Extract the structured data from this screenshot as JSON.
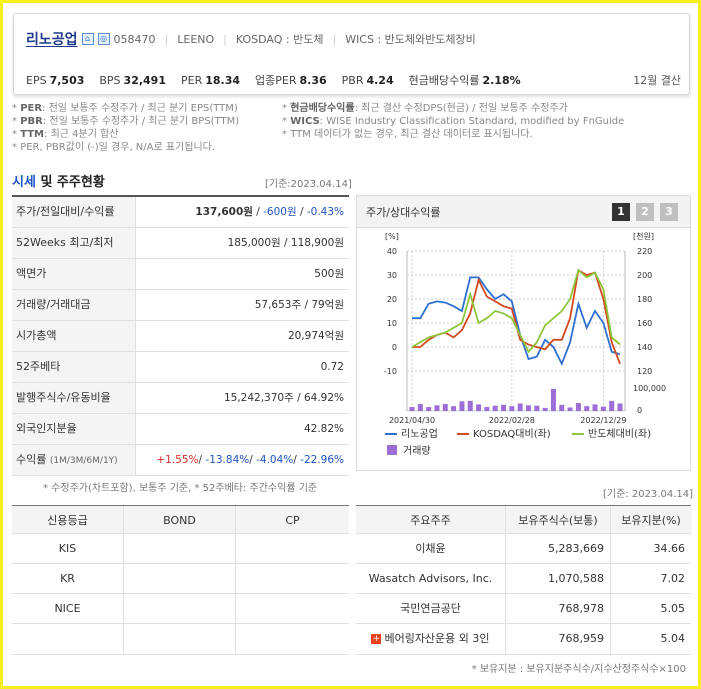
{
  "header": {
    "company_name": "리노공업",
    "code": "058470",
    "english_name": "LEENO",
    "market": "KOSDAQ : 반도체",
    "wics": "WICS : 반도체와반도체장비",
    "metrics": [
      {
        "label": "EPS",
        "value": "7,503"
      },
      {
        "label": "BPS",
        "value": "32,491"
      },
      {
        "label": "PER",
        "value": "18.34"
      },
      {
        "label": "업종PER",
        "value": "8.36"
      },
      {
        "label": "PBR",
        "value": "4.24"
      },
      {
        "label": "현금배당수익률",
        "value": "2.18%"
      }
    ],
    "settlement": "12월 결산"
  },
  "notes_left": [
    {
      "k": "PER",
      "t": ": 전일 보통주 수정주가 / 최근 분기 EPS(TTM)"
    },
    {
      "k": "PBR",
      "t": ": 전일 보통주 수정주가 / 최근 분기 BPS(TTM)"
    },
    {
      "k": "TTM",
      "t": ": 최근 4분기 합산"
    },
    {
      "k": "",
      "t": "PER, PBR값이 (-)일 경우, N/A로 표기됩니다."
    }
  ],
  "notes_right": [
    {
      "k": "현금배당수익률",
      "t": ": 최근 결산 수정DPS(현금) / 전일 보통주 수정주가"
    },
    {
      "k": "WICS",
      "t": ": WISE Industry Classification Standard, modified by FnGuide"
    },
    {
      "k": "",
      "t": "TTM 데이터가 없는 경우, 최근 결산 데이터로 표시됩니다."
    }
  ],
  "section": {
    "title_blue": "시세",
    "title_rest": " 및 주주현황",
    "basis": "[기준:2023.04.14]"
  },
  "market_table": [
    {
      "label": "주가/전일대비/수익률",
      "value_html": "price"
    },
    {
      "label": "52Weeks 최고/최저",
      "value": "185,000원 / 118,900원"
    },
    {
      "label": "액면가",
      "value": "500원"
    },
    {
      "label": "거래량/거래대금",
      "value": "57,653주 / 79억원"
    },
    {
      "label": "시가총액",
      "value": "20,974억원"
    },
    {
      "label": "52주베타",
      "value": "0.72"
    },
    {
      "label": "발행주식수/유동비율",
      "value": "15,242,370주 / 64.92%"
    },
    {
      "label": "외국인지분율",
      "value": "42.82%"
    },
    {
      "label": "수익률",
      "label_small": "(1M/3M/6M/1Y)",
      "value_html": "returns"
    }
  ],
  "price": {
    "price": "137,600원",
    "change": "-600원",
    "rate": "-0.43%"
  },
  "returns": {
    "r1m": "+1.55%",
    "r3m": "-13.84%",
    "r6m": "-4.04%",
    "r1y": "-22.96%"
  },
  "market_note": "* 수정주가(차트포함), 보통주 기준, * 52주베타: 주간수익률 기준",
  "chart_panel": {
    "title": "주가/상대수익률",
    "pages": [
      "1",
      "2",
      "3"
    ]
  },
  "chart_data": {
    "type": "line",
    "title": "",
    "ylabel_left": "[%]",
    "ylabel_right": "[천원]",
    "ylim_left": [
      -10,
      40
    ],
    "yticks_left": [
      -10,
      0,
      10,
      20,
      30,
      40
    ],
    "ylim_right": [
      120,
      220
    ],
    "yticks_right": [
      120,
      140,
      160,
      180,
      200,
      220
    ],
    "volume_ticks": [
      "100,000",
      "0"
    ],
    "x_labels": [
      "2021/04/30",
      "2022/02/28",
      "2022/12/29"
    ],
    "series": [
      {
        "name": "리노공업",
        "color": "#2f6fd1",
        "values": [
          12,
          12,
          18,
          19,
          18.5,
          17,
          15,
          29,
          29,
          24,
          20,
          22,
          19,
          5,
          -5,
          -4,
          3,
          0,
          -7,
          2,
          18,
          8,
          15,
          10,
          -2,
          -3
        ]
      },
      {
        "name": "KOSDAQ대비(좌)",
        "color": "#d24a20",
        "values": [
          0,
          0,
          3,
          5,
          6,
          4,
          7,
          14,
          28,
          21,
          19,
          17,
          16,
          3,
          1,
          0,
          -1,
          3,
          3,
          12,
          32,
          30,
          31,
          20,
          2,
          -7
        ]
      },
      {
        "name": "반도체대비(좌)",
        "color": "#8fc53a",
        "values": [
          0,
          2,
          4,
          5,
          6,
          8,
          10,
          22,
          10,
          12,
          15,
          14,
          12,
          5,
          -2,
          2,
          9,
          12,
          15,
          20,
          32,
          29,
          31,
          24,
          4,
          1
        ]
      },
      {
        "name": "거래량",
        "color": "#9b6fd6",
        "type": "bar",
        "values": [
          18,
          32,
          18,
          26,
          32,
          22,
          44,
          46,
          30,
          18,
          24,
          28,
          22,
          34,
          26,
          24,
          14,
          100,
          28,
          16,
          36,
          22,
          30,
          20,
          46,
          34
        ]
      }
    ]
  },
  "credit_table": {
    "headers": [
      "신용등급",
      "BOND",
      "CP"
    ],
    "rows": [
      [
        "KIS",
        "",
        ""
      ],
      [
        "KR",
        "",
        ""
      ],
      [
        "NICE",
        "",
        ""
      ],
      [
        "",
        "",
        ""
      ]
    ]
  },
  "holders_basis": "[기준: 2023.04.14]",
  "holders_table": {
    "headers": [
      "주요주주",
      "보유주식수(보통)",
      "보유지분(%)"
    ],
    "rows": [
      [
        "이채윤",
        "5,283,669",
        "34.66"
      ],
      [
        "Wasatch Advisors, Inc.",
        "1,070,588",
        "7.02"
      ],
      [
        "국민연금공단",
        "768,978",
        "5.05"
      ],
      [
        "베어링자산운용 외 3인",
        "768,959",
        "5.04"
      ]
    ]
  },
  "holders_note": "* 보유지분 : 보유지분주식수/지수산정주식수×100"
}
